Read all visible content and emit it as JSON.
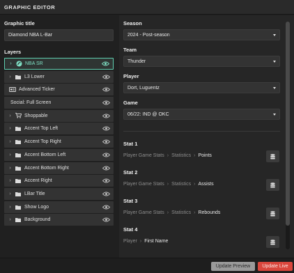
{
  "header": {
    "title": "GRAPHIC EDITOR"
  },
  "left": {
    "graphic_title_label": "Graphic title",
    "graphic_title_value": "Diamond NBA L-Bar",
    "layers_label": "Layers",
    "layers": [
      {
        "name": "NBA SR",
        "icon": "nba-logo-icon",
        "expandable": true,
        "selected": true
      },
      {
        "name": "L3 Lower",
        "icon": "folder-icon",
        "expandable": true,
        "selected": false
      },
      {
        "name": "Advanced Ticker",
        "icon": "ticker-icon",
        "expandable": false,
        "selected": false
      },
      {
        "name": "Social: Full Screen",
        "icon": "",
        "expandable": false,
        "selected": false
      },
      {
        "name": "Shoppable",
        "icon": "cart-icon",
        "expandable": true,
        "selected": false
      },
      {
        "name": "Accent Top Left",
        "icon": "folder-icon",
        "expandable": true,
        "selected": false
      },
      {
        "name": "Accent Top Right",
        "icon": "folder-icon",
        "expandable": true,
        "selected": false
      },
      {
        "name": "Accent Bottom Left",
        "icon": "folder-icon",
        "expandable": true,
        "selected": false
      },
      {
        "name": "Accent Bottom Right",
        "icon": "folder-icon",
        "expandable": true,
        "selected": false
      },
      {
        "name": "Accent Right",
        "icon": "folder-icon",
        "expandable": true,
        "selected": false
      },
      {
        "name": "LBar Title",
        "icon": "folder-icon",
        "expandable": true,
        "selected": false
      },
      {
        "name": "Show Logo",
        "icon": "folder-icon",
        "expandable": true,
        "selected": false
      },
      {
        "name": "Background",
        "icon": "folder-icon",
        "expandable": true,
        "selected": false
      }
    ]
  },
  "right": {
    "season": {
      "label": "Season",
      "value": "2024 - Post-season"
    },
    "team": {
      "label": "Team",
      "value": "Thunder"
    },
    "player": {
      "label": "Player",
      "value": "Dort, Luguentz"
    },
    "game": {
      "label": "Game",
      "value": "06/22: IND @ OKC"
    },
    "stats": [
      {
        "label": "Stat 1",
        "path": [
          "Player Game Stats",
          "Statistics"
        ],
        "leaf": "Points"
      },
      {
        "label": "Stat 2",
        "path": [
          "Player Game Stats",
          "Statistics"
        ],
        "leaf": "Assists"
      },
      {
        "label": "Stat 3",
        "path": [
          "Player Game Stats",
          "Statistics"
        ],
        "leaf": "Rebounds"
      },
      {
        "label": "Stat 4",
        "path": [
          "Player"
        ],
        "leaf": "First Name"
      }
    ]
  },
  "footer": {
    "preview_label": "Update Preview",
    "live_label": "Update Live"
  },
  "colors": {
    "accent": "#5fd0b0",
    "live": "#d9463c",
    "panel": "#262626"
  }
}
